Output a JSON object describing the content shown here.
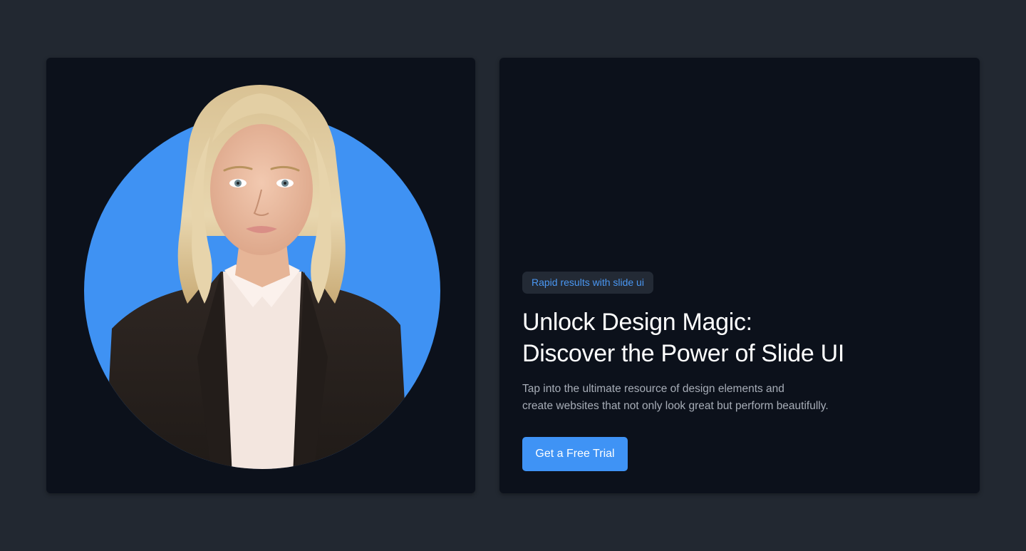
{
  "hero": {
    "badge_text": "Rapid results with slide ui",
    "headline_line1": "Unlock Design Magic:",
    "headline_line2": "Discover the Power of Slide UI",
    "description_line1": "Tap into the ultimate resource of design elements and",
    "description_line2": "create websites that not only look great but perform beautifully.",
    "cta_label": "Get a Free Trial"
  },
  "image": {
    "subject": "portrait of a blonde woman in a dark blazer and white blouse on a blue circle"
  },
  "colors": {
    "page_background": "#222831",
    "card_background": "#0c111b",
    "accent_blue": "#3f93f5",
    "circle_blue": "#3f92f3",
    "badge_background": "#232a35",
    "badge_text": "#4a97f2",
    "headline": "#ffffff",
    "body_text": "#a7adb7"
  }
}
